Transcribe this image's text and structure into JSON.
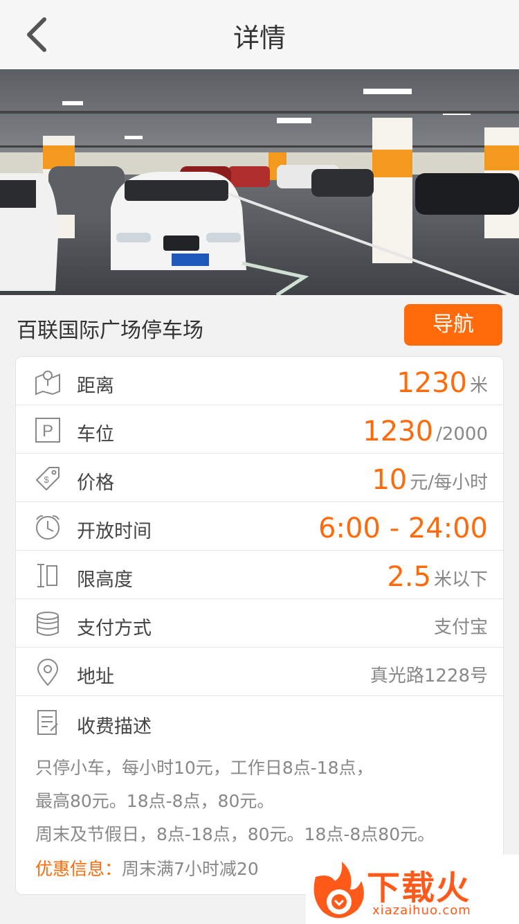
{
  "header": {
    "title": "详情"
  },
  "lot": {
    "name": "百联国际广场停车场",
    "navigate_label": "导航"
  },
  "details": {
    "distance": {
      "label": "距离",
      "value": "1230",
      "unit": "米"
    },
    "spaces": {
      "label": "车位",
      "value": "1230",
      "unit": "/2000"
    },
    "price": {
      "label": "价格",
      "value": "10",
      "unit": "元/每小时"
    },
    "hours": {
      "label": "开放时间",
      "value": "6:00 - 24:00"
    },
    "height": {
      "label": "限高度",
      "value": "2.5",
      "unit": "米以下"
    },
    "payment": {
      "label": "支付方式",
      "value": "支付宝"
    },
    "address": {
      "label": "地址",
      "value": "真光路1228号"
    }
  },
  "fees": {
    "label": "收费描述",
    "lines": [
      "只停小车，每小时10元，工作日8点-18点，",
      "最高80元。18点-8点，80元。",
      "周末及节假日，8点-18点，80元。18点-8点80元。"
    ],
    "promo_label": "优惠信息：",
    "promo_text": "周末满7小时减20"
  },
  "watermark": {
    "text": "下载火",
    "url": "xiazaihuo.com"
  },
  "colors": {
    "accent": "#ff6a0a",
    "text": "#333333",
    "muted": "#888888"
  },
  "icons": [
    "chevron-left-icon",
    "map-icon",
    "parking-icon",
    "price-tag-icon",
    "clock-icon",
    "height-limit-icon",
    "coins-icon",
    "location-pin-icon",
    "document-icon"
  ]
}
